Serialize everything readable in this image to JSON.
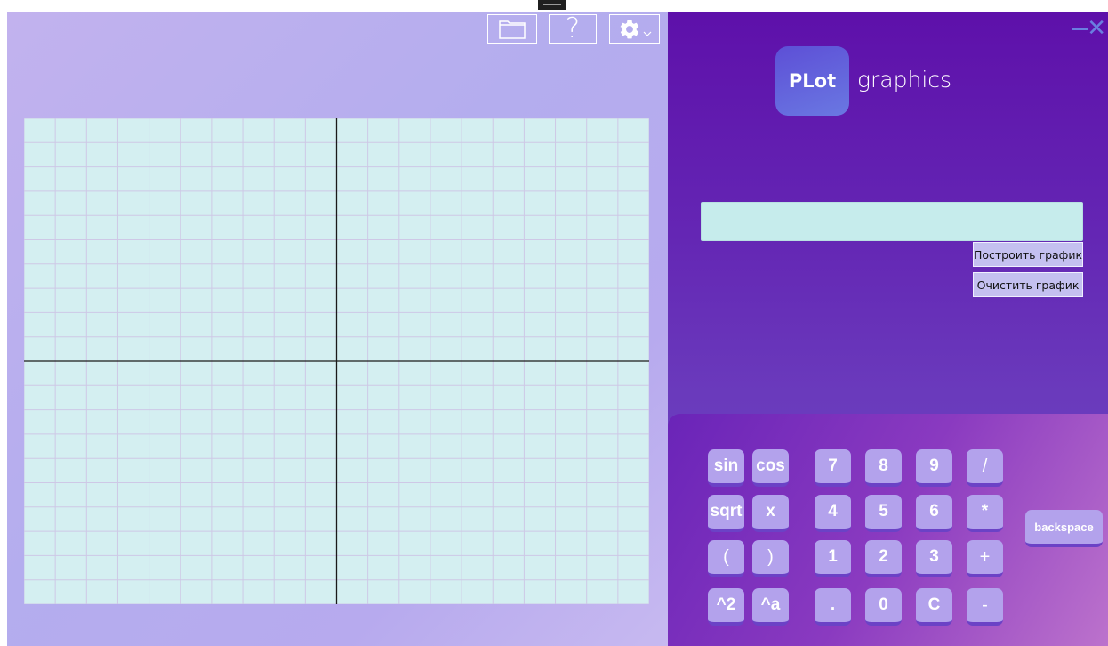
{
  "toolbar": {
    "open_icon": "folder-icon",
    "help_label": "?",
    "settings_icon": "gear-icon",
    "settings_dropdown_icon": "chevron-down-icon"
  },
  "window": {
    "minimize_icon": "minimize-icon",
    "close_label": "✕"
  },
  "logo": {
    "badge": "PLot",
    "text": "graphics"
  },
  "function_input": {
    "value": "",
    "placeholder": ""
  },
  "actions": {
    "build": "Построить график",
    "clear": "Очистить график"
  },
  "graph": {
    "x_range": [
      -10,
      10
    ],
    "y_range": [
      -10,
      10
    ],
    "grid": true,
    "background_color": "#d4eff1",
    "grid_color": "#cec8e6",
    "axis_color": "#1a1a1a"
  },
  "keypad": {
    "functions": [
      [
        "sin",
        "cos"
      ],
      [
        "sqrt",
        "x"
      ],
      [
        "(",
        ")"
      ],
      [
        "^2",
        "^a"
      ]
    ],
    "digits": [
      [
        "7",
        "8",
        "9",
        "/"
      ],
      [
        "4",
        "5",
        "6",
        "*"
      ],
      [
        "1",
        "2",
        "3",
        "+"
      ],
      [
        ".",
        "0",
        "C",
        "-"
      ]
    ],
    "backspace": "backspace"
  },
  "colors": {
    "left_panel": "#b7aeee",
    "right_panel": "#6426b4",
    "key_face": "#b3a2ec",
    "key_shadow": "#6b42c6",
    "input_bg": "#c6ecec",
    "accent_close": "#6a7ee0"
  }
}
